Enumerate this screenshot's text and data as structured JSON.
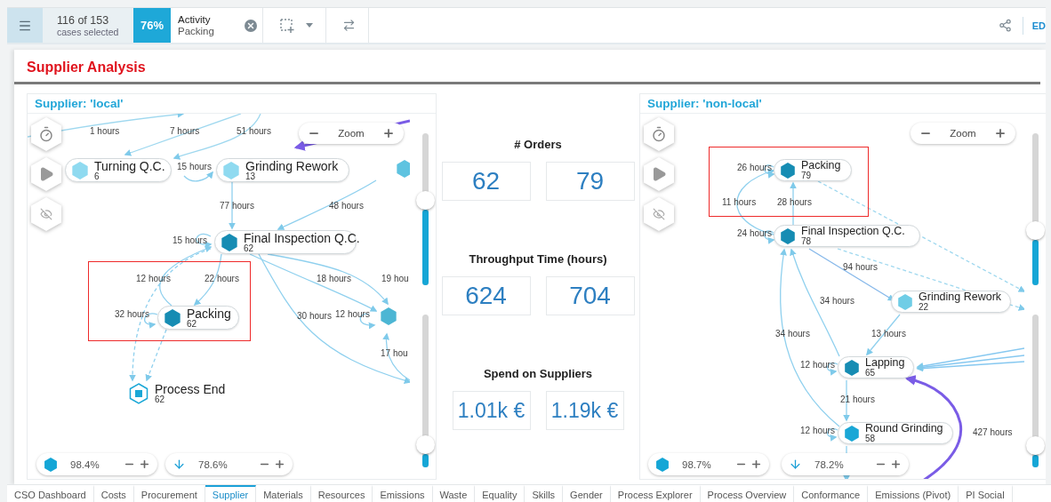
{
  "toolbar": {
    "case_count": "116 of 153",
    "case_caption": "cases selected",
    "share": "76%",
    "filter": {
      "label": "Activity",
      "value": "Packing"
    },
    "edit_label": "ED"
  },
  "page_title": "Supplier Analysis",
  "graphs": [
    {
      "title": "Supplier: 'local'",
      "zoom_label": "Zoom",
      "activity_level": "98.4%",
      "path_level": "78.6%",
      "nodes": [
        {
          "kind": "activity",
          "name": "Turning Q.C.",
          "count": "6",
          "color": "#8fdaf0",
          "highlighted": false
        },
        {
          "kind": "activity",
          "name": "Grinding Rework",
          "count": "13",
          "color": "#8fdaf0",
          "highlighted": false
        },
        {
          "kind": "partial",
          "color": "#5ec3e0",
          "highlighted": false
        },
        {
          "kind": "activity",
          "name": "Final Inspection Q.C.",
          "count": "62",
          "color": "#168cb3",
          "highlighted": false
        },
        {
          "kind": "activity",
          "name": "Packing",
          "count": "62",
          "color": "#168cb3",
          "highlighted": true
        },
        {
          "kind": "partial",
          "color": "#4cb6d4",
          "highlighted": false
        },
        {
          "kind": "end",
          "name": "Process End",
          "count": "62",
          "color": "#1aa7d6",
          "highlighted": false
        }
      ],
      "edge_labels": [
        "1 hours",
        "7 hours",
        "51 hours",
        "15 hours",
        "77 hours",
        "48 hours",
        "15 hours",
        "12 hours",
        "22 hours",
        "18 hours",
        "19 hou",
        "32 hours",
        "30 hours",
        "12 hours",
        "17 hou"
      ],
      "sliders": [
        {
          "level": 0.5
        },
        {
          "level": 0.09
        }
      ]
    },
    {
      "title": "Supplier: 'non-local'",
      "zoom_label": "Zoom",
      "activity_level": "98.7%",
      "path_level": "78.2%",
      "nodes": [
        {
          "kind": "activity",
          "name": "Packing",
          "count": "79",
          "color": "#168cb3",
          "highlighted": true
        },
        {
          "kind": "activity",
          "name": "Final Inspection Q.C.",
          "count": "78",
          "color": "#168cb3",
          "highlighted": false
        },
        {
          "kind": "activity",
          "name": "Grinding Rework",
          "count": "22",
          "color": "#6fcde6",
          "highlighted": false
        },
        {
          "kind": "activity",
          "name": "Lapping",
          "count": "65",
          "color": "#168cb3",
          "highlighted": false
        },
        {
          "kind": "activity",
          "name": "Round Grinding",
          "count": "58",
          "color": "#1aa7d6",
          "highlighted": false
        }
      ],
      "edge_labels": [
        "26 hours",
        "11 hours",
        "28 hours",
        "24 hours",
        "94 hours",
        "34 hours",
        "34 hours",
        "13 hours",
        "12 hours",
        "21 hours",
        "12 hours",
        "427 hours"
      ],
      "sliders": [
        {
          "level": 0.3
        },
        {
          "level": 0.08
        }
      ]
    }
  ],
  "kpis": [
    {
      "title": "# Orders",
      "values": [
        "62",
        "79"
      ]
    },
    {
      "title": "Throughput Time (hours)",
      "values": [
        "624",
        "704"
      ]
    },
    {
      "title": "Spend on Suppliers",
      "values": [
        "1.01k €",
        "1.19k €"
      ]
    }
  ],
  "tabs": [
    {
      "label": "CSO Dashboard",
      "selected": false
    },
    {
      "label": "Costs",
      "selected": false
    },
    {
      "label": "Procurement",
      "selected": false
    },
    {
      "label": "Supplier",
      "selected": true
    },
    {
      "label": "Materials",
      "selected": false
    },
    {
      "label": "Resources",
      "selected": false
    },
    {
      "label": "Emissions",
      "selected": false
    },
    {
      "label": "Waste",
      "selected": false
    },
    {
      "label": "Equality",
      "selected": false
    },
    {
      "label": "Skills",
      "selected": false
    },
    {
      "label": "Gender",
      "selected": false
    },
    {
      "label": "Process Explorer",
      "selected": false
    },
    {
      "label": "Process Overview",
      "selected": false
    },
    {
      "label": "Conformance",
      "selected": false
    },
    {
      "label": "Emissions (Pivot)",
      "selected": false
    },
    {
      "label": "PI Social",
      "selected": false
    }
  ]
}
